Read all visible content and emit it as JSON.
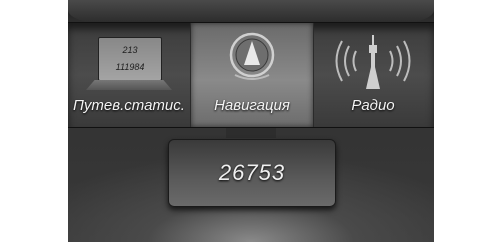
{
  "menu": {
    "items": [
      {
        "label": "Путев.статис.",
        "icon": "trip-computer-icon",
        "selected": false,
        "values": [
          "213",
          "111984"
        ]
      },
      {
        "label": "Навигация",
        "icon": "compass-icon",
        "selected": true
      },
      {
        "label": "Радио",
        "icon": "radio-tower-icon",
        "selected": false
      }
    ]
  },
  "odometer": {
    "value": "26753"
  }
}
